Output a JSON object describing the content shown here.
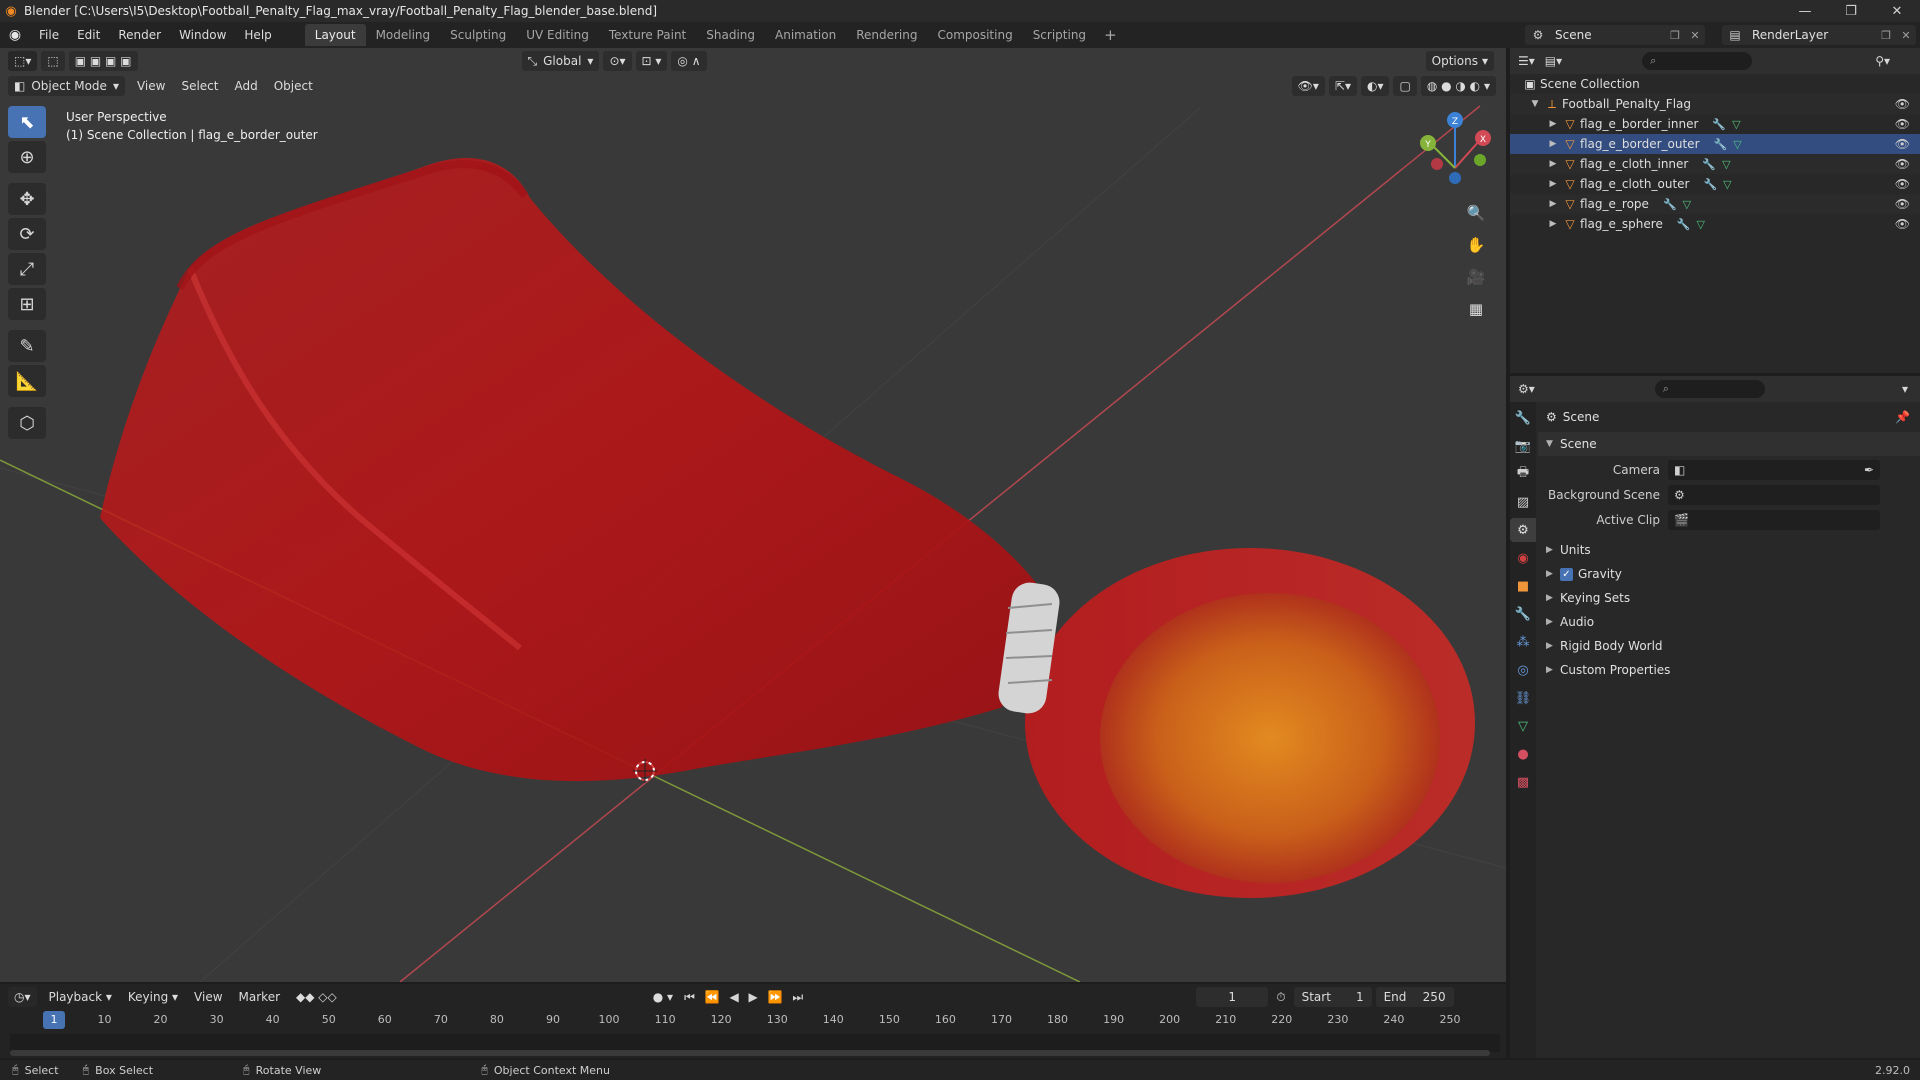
{
  "window": {
    "title": "Blender [C:\\Users\\I5\\Desktop\\Football_Penalty_Flag_max_vray/Football_Penalty_Flag_blender_base.blend]",
    "controls": [
      "—",
      "❐",
      "✕"
    ]
  },
  "menu": {
    "items": [
      "File",
      "Edit",
      "Render",
      "Window",
      "Help"
    ]
  },
  "workspaces": {
    "tabs": [
      "Layout",
      "Modeling",
      "Sculpting",
      "UV Editing",
      "Texture Paint",
      "Shading",
      "Animation",
      "Rendering",
      "Compositing",
      "Scripting"
    ],
    "active": "Layout",
    "add": "+"
  },
  "scene_selector": {
    "value": "Scene"
  },
  "renderlayer_selector": {
    "value": "RenderLayer"
  },
  "viewport": {
    "mode": "Object Mode",
    "menus": [
      "View",
      "Select",
      "Add",
      "Object"
    ],
    "orientation": "Global",
    "options": "Options",
    "perspective": "User Perspective",
    "collection_info": "(1) Scene Collection | flag_e_border_outer",
    "gizmo_labels": {
      "x": "X",
      "y": "Y",
      "z": "Z"
    }
  },
  "outliner": {
    "root": "Scene Collection",
    "collection": "Football_Penalty_Flag",
    "objects": [
      {
        "name": "flag_e_border_inner",
        "selected": false
      },
      {
        "name": "flag_e_border_outer",
        "selected": true
      },
      {
        "name": "flag_e_cloth_inner",
        "selected": false
      },
      {
        "name": "flag_e_cloth_outer",
        "selected": false
      },
      {
        "name": "flag_e_rope",
        "selected": false
      },
      {
        "name": "flag_e_sphere",
        "selected": false
      }
    ]
  },
  "properties": {
    "breadcrumb": "Scene",
    "panel_title": "Scene",
    "fields": [
      {
        "label": "Camera",
        "value": ""
      },
      {
        "label": "Background Scene",
        "value": ""
      },
      {
        "label": "Active Clip",
        "value": ""
      }
    ],
    "subpanels": [
      "Units",
      "Gravity",
      "Keying Sets",
      "Audio",
      "Rigid Body World",
      "Custom Properties"
    ],
    "gravity_checked": true
  },
  "timeline": {
    "menus": [
      "Playback",
      "Keying",
      "View",
      "Marker"
    ],
    "current_frame": "1",
    "start_label": "Start",
    "start": "1",
    "end_label": "End",
    "end": "250",
    "ticks": [
      "10",
      "20",
      "30",
      "40",
      "50",
      "60",
      "70",
      "80",
      "90",
      "100",
      "110",
      "120",
      "130",
      "140",
      "150",
      "160",
      "170",
      "180",
      "190",
      "200",
      "210",
      "220",
      "230",
      "240",
      "250"
    ],
    "cursor": "1"
  },
  "statusbar": {
    "items": [
      "Select",
      "Box Select",
      "Rotate View",
      "Object Context Menu"
    ],
    "version": "2.92.0"
  },
  "colors": {
    "accent": "#4772b3",
    "flag_red": "#c8191b",
    "sphere_orange": "#d9731a",
    "axis_x": "#d24a55",
    "axis_y": "#86b43b",
    "axis_z": "#3b82d6"
  }
}
